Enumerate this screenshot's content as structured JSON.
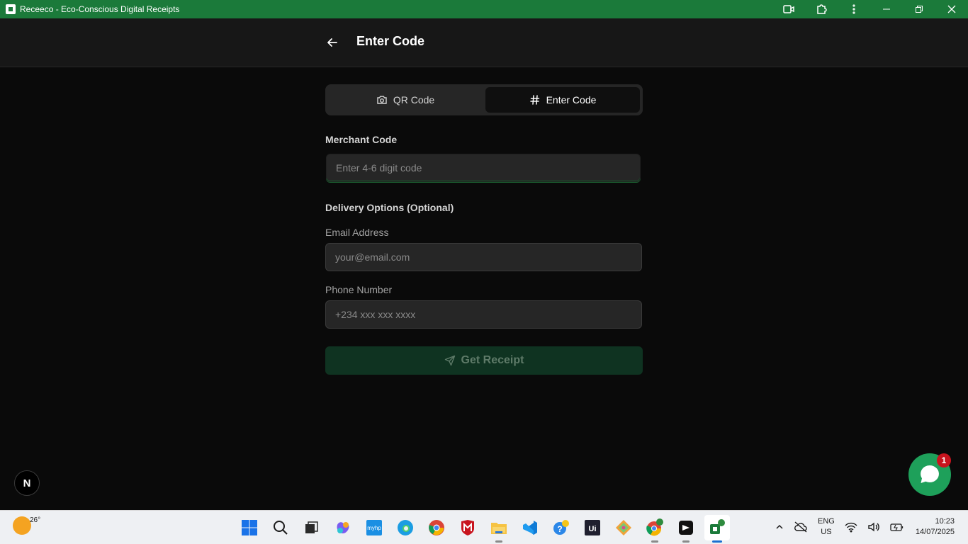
{
  "window": {
    "title": "Receeco - Eco-Conscious Digital Receipts",
    "controls": [
      "camera-icon",
      "extensions-icon",
      "more-icon",
      "minimize-icon",
      "restore-icon",
      "close-icon"
    ]
  },
  "header": {
    "title": "Enter Code"
  },
  "tabs": [
    {
      "label": "QR Code",
      "icon": "camera-icon",
      "active": false
    },
    {
      "label": "Enter Code",
      "icon": "hash-icon",
      "active": true
    }
  ],
  "merchant": {
    "label": "Merchant Code",
    "placeholder": "Enter 4-6 digit code"
  },
  "delivery": {
    "heading": "Delivery Options (Optional)",
    "email": {
      "label": "Email Address",
      "placeholder": "your@email.com"
    },
    "phone": {
      "label": "Phone Number",
      "placeholder": "+234 xxx xxx xxxx"
    }
  },
  "submit": {
    "label": "Get Receipt"
  },
  "next_badge": "N",
  "chat": {
    "unread": "1"
  },
  "taskbar": {
    "weather_temp": "26°",
    "apps": [
      "start-icon",
      "search-icon",
      "task-view-icon",
      "copilot-icon",
      "myhp-icon",
      "edge-icon",
      "chrome-icon",
      "mcafee-icon",
      "file-explorer-icon",
      "vscode-icon",
      "help-icon",
      "uipath-icon",
      "git-icon",
      "chrome-profile-icon",
      "capcut-icon",
      "receeco-app-icon"
    ],
    "lang_line1": "ENG",
    "lang_line2": "US",
    "time": "10:23",
    "date": "14/07/2025"
  },
  "colors": {
    "accent": "#1b7a3a",
    "chat": "#1ea05a",
    "badge": "#c8141e"
  }
}
